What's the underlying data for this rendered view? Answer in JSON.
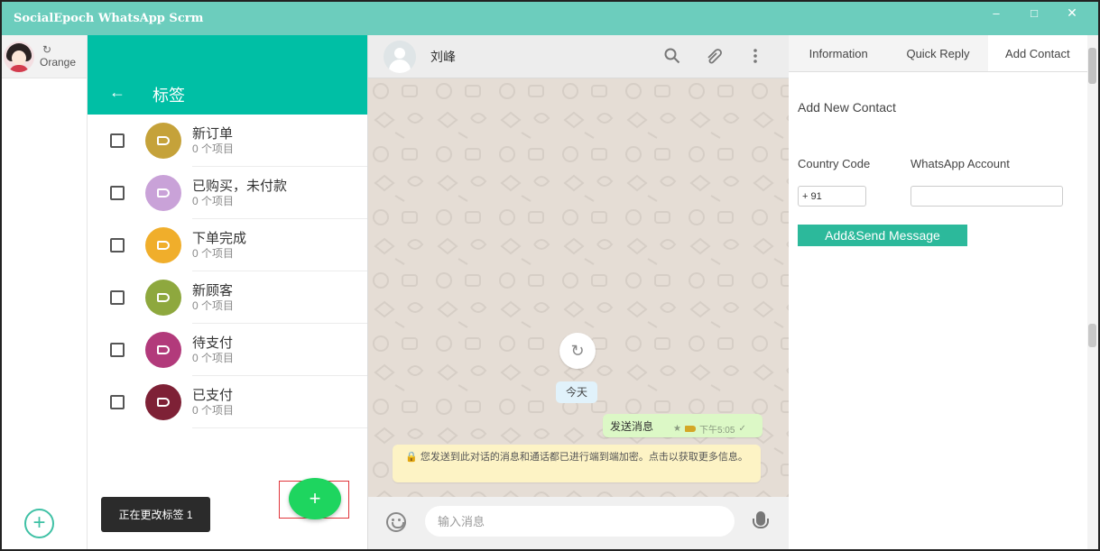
{
  "app": {
    "title": "SocialEpoch WhatsApp Scrm"
  },
  "window_controls": {
    "minimize": "–",
    "maximize": "□",
    "close": "✕"
  },
  "account": {
    "refresh": "↻",
    "name": "Orange",
    "add": "+"
  },
  "labels_panel": {
    "back": "←",
    "title": "标签",
    "items": [
      {
        "name": "新订单",
        "count": "0 个项目",
        "color": "#c5a23a"
      },
      {
        "name": "已购买，未付款",
        "count": "0 个项目",
        "color": "#c9a2d8"
      },
      {
        "name": "下单完成",
        "count": "0 个项目",
        "color": "#f0ae2b"
      },
      {
        "name": "新顾客",
        "count": "0 个项目",
        "color": "#8ea83e"
      },
      {
        "name": "待支付",
        "count": "0 个项目",
        "color": "#b23a7b"
      },
      {
        "name": "已支付",
        "count": "0 个项目",
        "color": "#7e2136"
      }
    ],
    "toast": "正在更改标签 1",
    "fab": "+"
  },
  "chat": {
    "contact_name": "刘峰",
    "refresh": "↻",
    "date_chip": "今天",
    "outgoing": {
      "text": "发送消息",
      "star": "★",
      "time": "下午5:05",
      "check": "✓"
    },
    "notice": "🔒 您发送到此对话的消息和通话都已进行端到端加密。点击以获取更多信息。",
    "input_placeholder": "输入消息"
  },
  "side_panel": {
    "tabs": [
      "Information",
      "Quick Reply",
      "Add Contact"
    ],
    "active_tab": 2,
    "title": "Add New Contact",
    "country_code_label": "Country Code",
    "whatsapp_label": "WhatsApp Account",
    "country_code_value": "+ 91",
    "whatsapp_value": "",
    "send_button": "Add&Send Message"
  },
  "colors": {
    "titlebar": "#6ccdbd",
    "header_teal": "#00bfa5",
    "accent_green": "#2cb99b",
    "fab": "#1ed55f"
  }
}
